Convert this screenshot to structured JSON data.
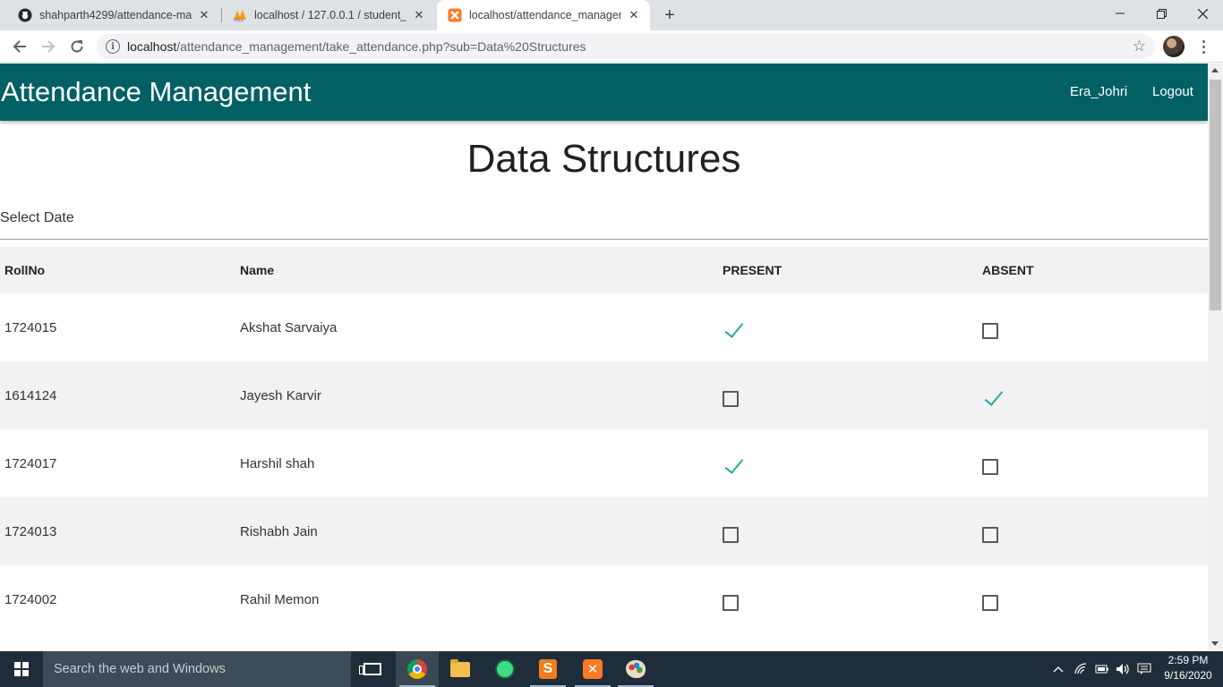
{
  "browser": {
    "tabs": [
      {
        "title": "shahparth4299/attendance-mana",
        "icon": "github-icon"
      },
      {
        "title": "localhost / 127.0.0.1 / student_ma",
        "icon": "phpmyadmin-icon"
      },
      {
        "title": "localhost/attendance_manageme",
        "icon": "xampp-icon",
        "active": true
      }
    ],
    "url_host": "localhost",
    "url_rest": "/attendance_management/take_attendance.php?sub=Data%20Structures"
  },
  "app": {
    "brand": "Attendance Management",
    "user": "Era_Johri",
    "logout": "Logout",
    "color": "#006064"
  },
  "subject": "Data Structures",
  "date_label": "Select Date",
  "table": {
    "columns": [
      "RollNo",
      "Name",
      "PRESENT",
      "ABSENT"
    ],
    "rows": [
      {
        "roll": "1724015",
        "name": "Akshat Sarvaiya",
        "present": true,
        "absent": false
      },
      {
        "roll": "1614124",
        "name": "Jayesh Karvir",
        "present": false,
        "absent": true
      },
      {
        "roll": "1724017",
        "name": "Harshil shah",
        "present": true,
        "absent": false
      },
      {
        "roll": "1724013",
        "name": "Rishabh Jain",
        "present": false,
        "absent": false
      },
      {
        "roll": "1724002",
        "name": "Rahil Memon",
        "present": false,
        "absent": false
      }
    ]
  },
  "taskbar": {
    "search_placeholder": "Search the web and Windows",
    "time": "2:59 PM",
    "date": "9/16/2020"
  }
}
